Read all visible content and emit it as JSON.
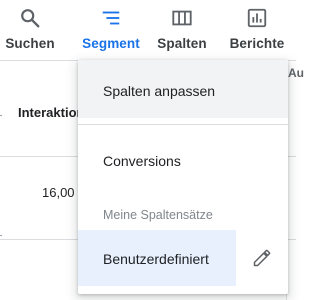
{
  "toolbar": {
    "accent_color": "#1a73e8",
    "items": [
      {
        "label": "Suchen",
        "icon": "search-icon",
        "active": false
      },
      {
        "label": "Segment",
        "icon": "segment-icon",
        "active": true
      },
      {
        "label": "Spalten",
        "icon": "columns-icon",
        "active": false
      },
      {
        "label": "Berichte",
        "icon": "reports-icon",
        "active": false
      }
    ]
  },
  "table": {
    "column_header": "Interaktionen",
    "column_header_edge": "Au",
    "cell_value": "16,00"
  },
  "menu": {
    "customize_label": "Spalten anpassen",
    "conversions_label": "Conversions",
    "section_label": "Meine Spaltensätze",
    "custom_set_label": "Benutzerdefiniert",
    "edit_icon": "pencil-icon",
    "highlight_color": "#e8f0fe"
  }
}
